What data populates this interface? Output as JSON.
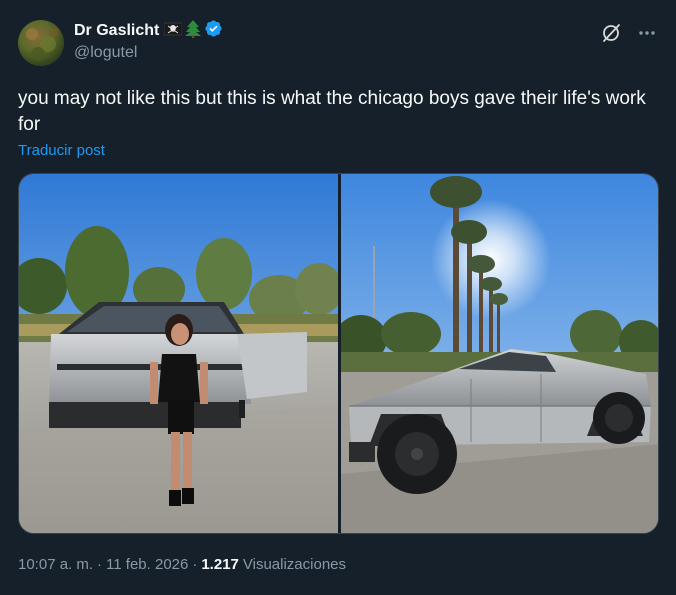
{
  "author": {
    "display_name": "Dr Gaslicht",
    "handle": "@logutel",
    "emoji": [
      "skull-and-crossbones-flag",
      "evergreen-tree"
    ],
    "verified": true
  },
  "tweet": {
    "text": "you may not like this but this is what the chicago boys gave their life's work for",
    "translate_label": "Traducir post"
  },
  "media": {
    "photo_count": 2
  },
  "meta": {
    "time": "10:07 a. m.",
    "separator": "·",
    "date": "11 feb. 2026",
    "views_count": "1.217",
    "views_label": "Visualizaciones"
  },
  "colors": {
    "background": "#15202b",
    "text_primary": "#f7f9f9",
    "text_secondary": "#8b98a5",
    "link": "#1d9bf0",
    "verified_badge": "#1d9bf0",
    "border": "#38444d"
  },
  "icons": {
    "grok": "grok-icon",
    "more": "more-options-icon",
    "verified": "verified-badge-icon"
  }
}
